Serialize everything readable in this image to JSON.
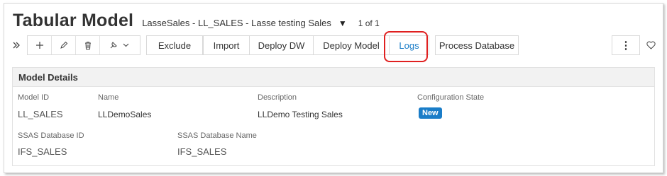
{
  "header": {
    "title": "Tabular Model",
    "record": "LasseSales - LL_SALES - Lasse testing Sales",
    "record_count": "1 of 1"
  },
  "toolbar": {
    "exclude": "Exclude",
    "import": "Import",
    "deploy_dw": "Deploy DW",
    "deploy_model": "Deploy Model",
    "logs": "Logs",
    "process_database": "Process Database"
  },
  "details": {
    "section_title": "Model Details",
    "model_id_label": "Model ID",
    "model_id": "LL_SALES",
    "name_label": "Name",
    "name": "LLDemoSales",
    "description_label": "Description",
    "description": "LLDemo Testing Sales",
    "config_state_label": "Configuration State",
    "config_state": "New",
    "ssas_db_id_label": "SSAS Database ID",
    "ssas_db_id": "IFS_SALES",
    "ssas_db_name_label": "SSAS Database Name",
    "ssas_db_name": "IFS_SALES"
  },
  "colors": {
    "accent": "#1a7dc8",
    "highlight": "#e02020"
  }
}
